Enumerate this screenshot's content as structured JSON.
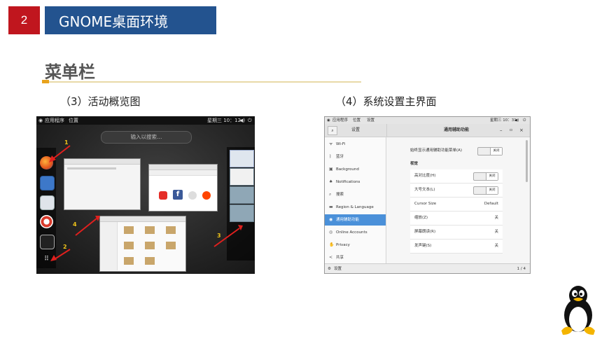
{
  "slide": {
    "number": "2",
    "title": "GNOME桌面环境",
    "section": "菜单栏",
    "caption_left": "（3）活动概览图",
    "caption_right": "（4）系统设置主界面"
  },
  "overview": {
    "topbar": {
      "apps": "应用程序",
      "places": "位置",
      "clock": "星期三 10：12"
    },
    "search_placeholder": "输入以搜索…",
    "labels": [
      "1",
      "2",
      "3",
      "4"
    ],
    "dock_icons": [
      "firefox-icon",
      "files-icon",
      "software-icon",
      "help-icon",
      "terminal-icon",
      "apps-grid-icon"
    ]
  },
  "settings": {
    "topbar": {
      "apps": "应用程序",
      "places": "位置",
      "app": "设置",
      "clock": "星期三 10：31"
    },
    "sidebar_title": "设置",
    "panel_title": "通用辅助功能",
    "sidebar": [
      {
        "label": "Wi-Fi",
        "icon": "wifi-icon"
      },
      {
        "label": "蓝牙",
        "icon": "bluetooth-icon"
      },
      {
        "label": "Background",
        "icon": "background-icon"
      },
      {
        "label": "Notifications",
        "icon": "bell-icon"
      },
      {
        "label": "搜索",
        "icon": "search-icon"
      },
      {
        "label": "Region & Language",
        "icon": "region-icon"
      },
      {
        "label": "通用辅助功能",
        "icon": "accessibility-icon"
      },
      {
        "label": "Online Accounts",
        "icon": "accounts-icon"
      },
      {
        "label": "Privacy",
        "icon": "privacy-icon"
      },
      {
        "label": "共享",
        "icon": "share-icon"
      }
    ],
    "always_show": {
      "label": "始终显示通用辅助功能菜单(A)",
      "value": "关闭"
    },
    "seeing_header": "视觉",
    "rows": [
      {
        "label": "高对比度(H)",
        "value": "关闭",
        "toggle": true
      },
      {
        "label": "大号文本(L)",
        "value": "关闭",
        "toggle": true
      },
      {
        "label": "Cursor Size",
        "value": "Default",
        "toggle": false
      },
      {
        "label": "缩放(Z)",
        "value": "关",
        "toggle": false
      },
      {
        "label": "屏幕朗读(R)",
        "value": "关",
        "toggle": false
      },
      {
        "label": "发声键(S)",
        "value": "关",
        "toggle": false
      }
    ],
    "footer": {
      "app": "设置",
      "page": "1 / 4"
    }
  }
}
